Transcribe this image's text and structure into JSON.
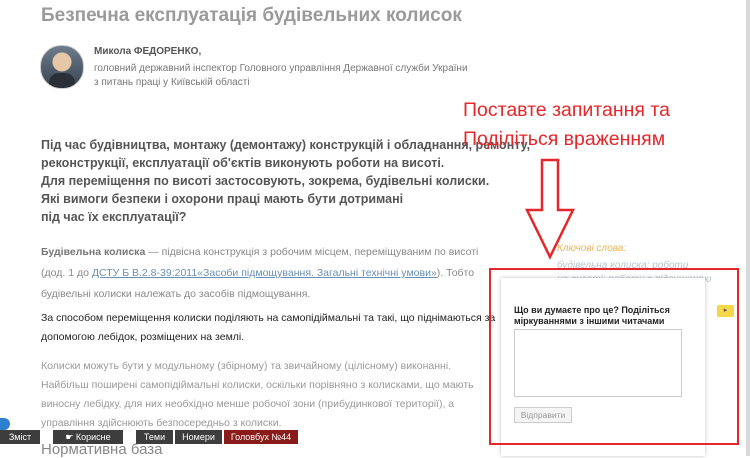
{
  "article": {
    "title": "Безпечна експлуатація будівельних колисок",
    "author_name": "Микола ФЕДОРЕНКО,",
    "author_position": "головний державний інспектор Головного управління Державної служби України з питань праці у Київській області",
    "lead_lines": [
      "Під час будівництва, монтажу (демонтажу) конструкцій і обладнання, ремонту,",
      "реконструкції, експлуатації об'єктів виконують роботи на висоті.",
      "Для переміщення по висоті застосовують, зокрема, будівельні колиски.",
      "Які вимоги безпеки і охорони праці мають бути дотримані",
      "під час їх експлуатації?"
    ],
    "p1_term": "Будівельна колиска",
    "p1_text_a": " — підвісна конструкція з робочим місцем, переміщуваним по висоті (дод. 1 до ",
    "p1_link": "ДСТУ Б В.2.8-39:2011«Засоби підмощування. Загальні технічні умови»",
    "p1_text_b": "). Тобто будівельні колиски належать до засобів підмощування.",
    "p2": "За способом переміщення колиски поділяють на самопідіймальні та такі, що піднімаються за допомогою лебідок, розміщених на землі.",
    "p3": "Колиски можуть бути у модульному (збірному) та звичайному (цілісному) виконанні. Найбільш поширені самопідіймальні колиски, оскільки порівняно з колисками, що мають виносну лебідку, для них необхідно менше робочої зони (прибудинкової території), а управління здійснюють безпосередньо з колиски.",
    "subheading": "Нормативна база"
  },
  "keywords": {
    "title": "Ключові слова:",
    "line1": "будівельна колиска; роботи",
    "line2": "на висоті; роботи з підвищеною"
  },
  "callout": {
    "line1": "Поставте запитання та",
    "line2": "Поділіться враженням"
  },
  "comment_panel": {
    "question": "Що ви думаєте про це? Поділіться міркуваннями з іншими читачами",
    "submit_label": "Відправити",
    "toggle_symbol": "▸"
  },
  "bottom_bar": {
    "contents_label": "Зміст",
    "useful_label": "Корисне",
    "topics_label": "Теми",
    "issues_label": "Номери",
    "magazine_label": "Головбух №44"
  },
  "colors": {
    "accent_red": "#e5262a",
    "bar_dark": "#3d3d3d",
    "bar_red": "#8a1b1b"
  }
}
